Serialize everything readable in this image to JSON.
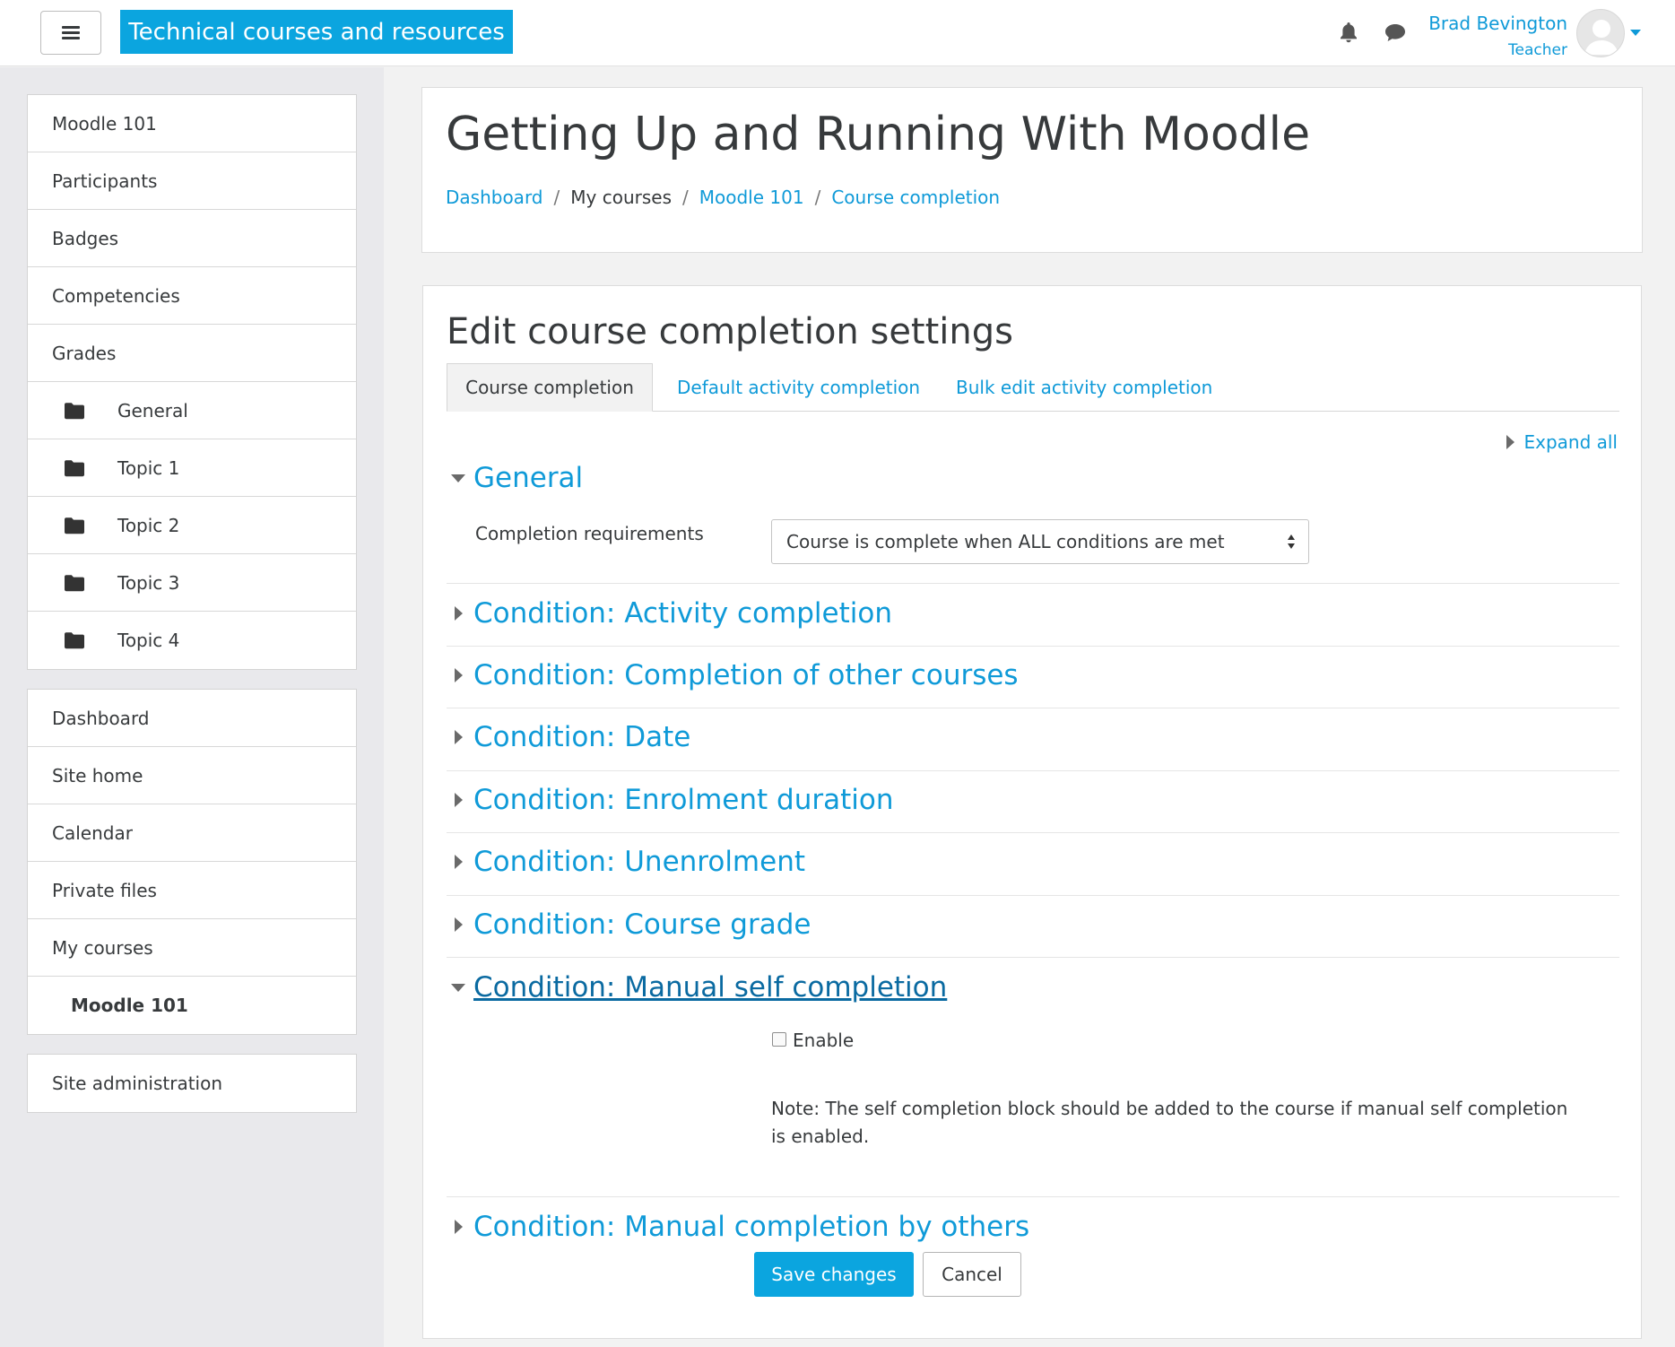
{
  "navbar": {
    "site_name": "Technical courses and resources",
    "user_name": "Brad Bevington",
    "user_role": "Teacher",
    "icons": [
      "menu-icon",
      "bell-icon",
      "chat-icon",
      "avatar",
      "caret-down-icon"
    ]
  },
  "drawer": {
    "course_items": [
      {
        "label": "Moodle 101"
      },
      {
        "label": "Participants"
      },
      {
        "label": "Badges"
      },
      {
        "label": "Competencies"
      },
      {
        "label": "Grades"
      },
      {
        "label": "General",
        "icon": "folder-icon"
      },
      {
        "label": "Topic 1",
        "icon": "folder-icon"
      },
      {
        "label": "Topic 2",
        "icon": "folder-icon"
      },
      {
        "label": "Topic 3",
        "icon": "folder-icon"
      },
      {
        "label": "Topic 4",
        "icon": "folder-icon"
      }
    ],
    "site_items": [
      {
        "label": "Dashboard"
      },
      {
        "label": "Site home"
      },
      {
        "label": "Calendar"
      },
      {
        "label": "Private files"
      },
      {
        "label": "My courses"
      },
      {
        "label": "Moodle 101"
      }
    ],
    "admin_items": [
      {
        "label": "Site administration"
      }
    ]
  },
  "header": {
    "title": "Getting Up and Running With Moodle",
    "breadcrumb": [
      {
        "label": "Dashboard",
        "link": true
      },
      {
        "label": "My courses",
        "link": false
      },
      {
        "label": "Moodle 101",
        "link": true
      },
      {
        "label": "Course completion",
        "link": true
      }
    ],
    "breadcrumb_separator": "/"
  },
  "main": {
    "title": "Edit course completion settings",
    "tabs": [
      {
        "label": "Course completion",
        "active": true
      },
      {
        "label": "Default activity completion",
        "active": false
      },
      {
        "label": "Bulk edit activity completion",
        "active": false
      }
    ],
    "expand_all": "Expand all",
    "general": {
      "header": "General",
      "completion_label": "Completion requirements",
      "completion_value": "Course is complete when ALL conditions are met"
    },
    "conditions": [
      {
        "label": "Condition: Activity completion",
        "expanded": false
      },
      {
        "label": "Condition: Completion of other courses",
        "expanded": false
      },
      {
        "label": "Condition: Date",
        "expanded": false
      },
      {
        "label": "Condition: Enrolment duration",
        "expanded": false
      },
      {
        "label": "Condition: Unenrolment",
        "expanded": false
      },
      {
        "label": "Condition: Course grade",
        "expanded": false
      },
      {
        "label": "Condition: Manual self completion",
        "expanded": true
      },
      {
        "label": "Condition: Manual completion by others",
        "expanded": false
      }
    ],
    "self_completion": {
      "enable_label": "Enable",
      "enabled": false,
      "note": "Note: The self completion block should be added to the course if manual self completion is enabled."
    },
    "buttons": {
      "save": "Save changes",
      "cancel": "Cancel"
    }
  },
  "colors": {
    "brand": "#0ba5df",
    "link": "#0f9ad8",
    "text": "#373a3c",
    "drawer_bg": "#e9e9ec",
    "page_bg": "#f2f2f2"
  }
}
